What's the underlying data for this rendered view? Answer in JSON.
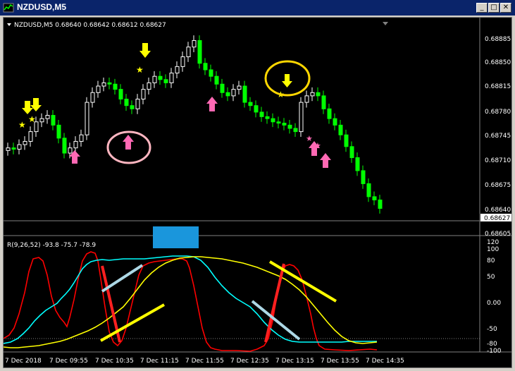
{
  "window": {
    "title": "NZDUSD,M5",
    "buttons": [
      "_",
      "□",
      "✕"
    ]
  },
  "price_panel": {
    "symbol_line": "NZDUSD,M5  0.68640 0.68642 0.68612 0.68627",
    "price_ticks": [
      "0.68885",
      "0.68850",
      "0.68815",
      "0.68780",
      "0.68745",
      "0.68710",
      "0.68675",
      "0.68640",
      "0.68605"
    ],
    "current_price": "0.68627"
  },
  "indicator_panel": {
    "label": "R(9,26,52) -93.8 -75.7 -78.9",
    "ticks_right": [
      "120",
      "100",
      "80",
      "50",
      "0.00",
      "-50",
      "-80",
      "-100"
    ]
  },
  "time_axis": [
    "7 Dec 2018",
    "7 Dec 09:55",
    "7 Dec 10:35",
    "7 Dec 11:15",
    "7 Dec 11:55",
    "7 Dec 12:35",
    "7 Dec 13:15",
    "7 Dec 13:55",
    "7 Dec 14:35"
  ],
  "colors": {
    "bull_candle": "#ffffff",
    "bear_candle": "#00ff00",
    "sell_arrow": "#ffff00",
    "buy_arrow": "#ff69b4",
    "line_red": "#ff0000",
    "line_cyan": "#00ffff",
    "line_yellow": "#ffff00",
    "blue_box": "#1a96dc"
  },
  "chart_data": [
    {
      "type": "candlestick",
      "title": "NZDUSD,M5",
      "ylim": [
        0.68595,
        0.68905
      ],
      "candles_close": [
        0.6872,
        0.68718,
        0.68725,
        0.6873,
        0.68745,
        0.6876,
        0.68765,
        0.6877,
        0.68755,
        0.68735,
        0.68712,
        0.6872,
        0.6873,
        0.6874,
        0.6879,
        0.68805,
        0.68815,
        0.6882,
        0.68818,
        0.6881,
        0.68795,
        0.68785,
        0.6878,
        0.68795,
        0.6881,
        0.6882,
        0.6883,
        0.68825,
        0.6882,
        0.68835,
        0.68845,
        0.6886,
        0.68875,
        0.68885,
        0.6885,
        0.6884,
        0.6883,
        0.68818,
        0.68805,
        0.688,
        0.6881,
        0.68815,
        0.6879,
        0.68785,
        0.68775,
        0.68768,
        0.68765,
        0.6876,
        0.68758,
        0.68755,
        0.6875,
        0.68745,
        0.6879,
        0.688,
        0.68805,
        0.688,
        0.6878,
        0.68765,
        0.68755,
        0.6874,
        0.68722,
        0.68705,
        0.68685,
        0.68665,
        0.68645,
        0.6864,
        0.68627
      ]
    },
    {
      "type": "line",
      "series": [
        {
          "name": "",
          "color": "#ff0000"
        },
        {
          "name": "",
          "color": "#00ffff"
        },
        {
          "name": "",
          "color": "#ffff00"
        }
      ],
      "ylim": [
        -100,
        120
      ]
    }
  ]
}
